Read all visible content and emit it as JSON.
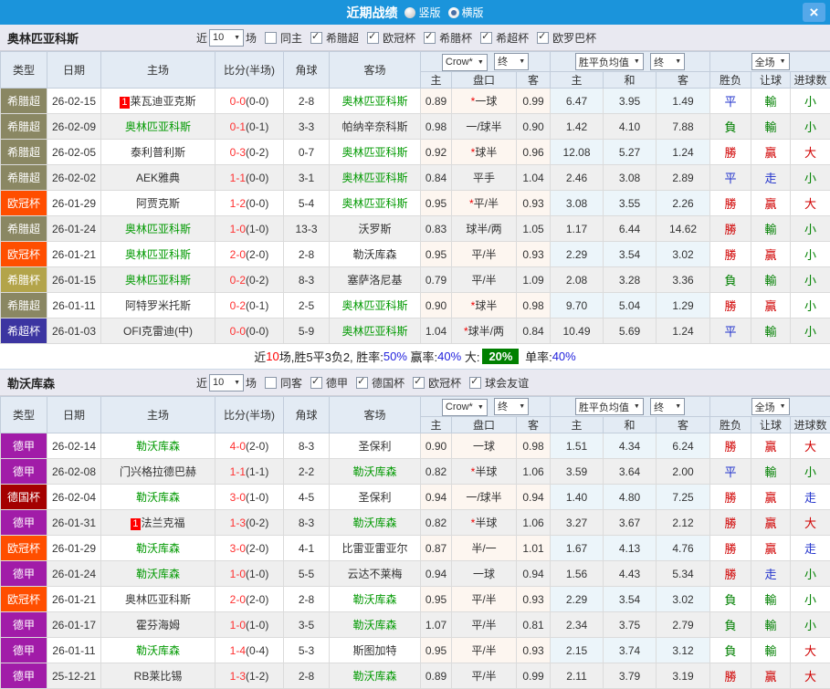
{
  "titlebar": {
    "title": "近期战绩",
    "vertical_label": "竖版",
    "horizontal_label": "横版",
    "selected_layout": "横版",
    "close_label": "×",
    "bar_color": "#1B94DB"
  },
  "table_header": {
    "cols": [
      "类型",
      "日期",
      "主场",
      "比分(半场)",
      "角球",
      "客场"
    ],
    "odds_dropdown": "Crow*",
    "final_dropdown": "终",
    "avg_dropdown": "胜平负均值",
    "final2_dropdown": "终",
    "fullgame_dropdown": "全场",
    "odds_cols": [
      "主",
      "盘口",
      "客"
    ],
    "avg_cols": [
      "主",
      "和",
      "客"
    ],
    "result_cols": [
      "胜负",
      "让球",
      "进球数"
    ]
  },
  "league_colors": {
    "希腊超": "#8A8763",
    "欧冠杯": "#FF4E00",
    "希腊杯": "#B3A44A",
    "希超杯": "#3C35A1",
    "德甲": "#A11CA8",
    "德国杯": "#A40000"
  },
  "result_colors": {
    "勝": "r",
    "贏": "r",
    "大": "r",
    "平": "b",
    "走": "b",
    "負": "g",
    "輸": "g",
    "小": "g"
  },
  "sections": [
    {
      "team": "奥林匹亚科斯",
      "filter": {
        "near": "近",
        "count": "10",
        "games": "场",
        "same": "同主",
        "same_checked": false,
        "leagues": [
          "希腊超",
          "欧冠杯",
          "希腊杯",
          "希超杯",
          "欧罗巴杯"
        ]
      },
      "rows": [
        {
          "league": "希腊超",
          "date": "26-02-15",
          "home": "莱瓦迪亚克斯",
          "home_badge": "1",
          "home_focus": false,
          "score": "0-0",
          "half": "(0-0)",
          "corners": "2-8",
          "away": "奥林匹亚科斯",
          "away_focus": true,
          "odds_home": "0.89",
          "handicap": "*一球",
          "odds_away": "0.99",
          "avg_home": "6.47",
          "avg_draw": "3.95",
          "avg_away": "1.49",
          "results": [
            "平",
            "輸",
            "小"
          ]
        },
        {
          "league": "希腊超",
          "date": "26-02-09",
          "home": "奥林匹亚科斯",
          "home_badge": "",
          "home_focus": true,
          "score": "0-1",
          "half": "(0-1)",
          "corners": "3-3",
          "away": "帕纳辛奈科斯",
          "away_focus": false,
          "odds_home": "0.98",
          "handicap": "一/球半",
          "odds_away": "0.90",
          "avg_home": "1.42",
          "avg_draw": "4.10",
          "avg_away": "7.88",
          "results": [
            "負",
            "輸",
            "小"
          ]
        },
        {
          "league": "希腊超",
          "date": "26-02-05",
          "home": "泰利普利斯",
          "home_badge": "",
          "home_focus": false,
          "score": "0-3",
          "half": "(0-2)",
          "corners": "0-7",
          "away": "奥林匹亚科斯",
          "away_focus": true,
          "odds_home": "0.92",
          "handicap": "*球半",
          "odds_away": "0.96",
          "avg_home": "12.08",
          "avg_draw": "5.27",
          "avg_away": "1.24",
          "results": [
            "勝",
            "贏",
            "大"
          ]
        },
        {
          "league": "希腊超",
          "date": "26-02-02",
          "home": "AEK雅典",
          "home_badge": "",
          "home_focus": false,
          "score": "1-1",
          "half": "(0-0)",
          "corners": "3-1",
          "away": "奥林匹亚科斯",
          "away_focus": true,
          "odds_home": "0.84",
          "handicap": "平手",
          "odds_away": "1.04",
          "avg_home": "2.46",
          "avg_draw": "3.08",
          "avg_away": "2.89",
          "results": [
            "平",
            "走",
            "小"
          ]
        },
        {
          "league": "欧冠杯",
          "date": "26-01-29",
          "home": "阿贾克斯",
          "home_badge": "",
          "home_focus": false,
          "score": "1-2",
          "half": "(0-0)",
          "corners": "5-4",
          "away": "奥林匹亚科斯",
          "away_focus": true,
          "odds_home": "0.95",
          "handicap": "*平/半",
          "odds_away": "0.93",
          "avg_home": "3.08",
          "avg_draw": "3.55",
          "avg_away": "2.26",
          "results": [
            "勝",
            "贏",
            "大"
          ]
        },
        {
          "league": "希腊超",
          "date": "26-01-24",
          "home": "奥林匹亚科斯",
          "home_badge": "",
          "home_focus": true,
          "score": "1-0",
          "half": "(1-0)",
          "corners": "13-3",
          "away": "沃罗斯",
          "away_focus": false,
          "odds_home": "0.83",
          "handicap": "球半/两",
          "odds_away": "1.05",
          "avg_home": "1.17",
          "avg_draw": "6.44",
          "avg_away": "14.62",
          "results": [
            "勝",
            "輸",
            "小"
          ]
        },
        {
          "league": "欧冠杯",
          "date": "26-01-21",
          "home": "奥林匹亚科斯",
          "home_badge": "",
          "home_focus": true,
          "score": "2-0",
          "half": "(2-0)",
          "corners": "2-8",
          "away": "勒沃库森",
          "away_focus": false,
          "odds_home": "0.95",
          "handicap": "平/半",
          "odds_away": "0.93",
          "avg_home": "2.29",
          "avg_draw": "3.54",
          "avg_away": "3.02",
          "results": [
            "勝",
            "贏",
            "小"
          ]
        },
        {
          "league": "希腊杯",
          "date": "26-01-15",
          "home": "奥林匹亚科斯",
          "home_badge": "",
          "home_focus": true,
          "score": "0-2",
          "half": "(0-2)",
          "corners": "8-3",
          "away": "塞萨洛尼基",
          "away_focus": false,
          "odds_home": "0.79",
          "handicap": "平/半",
          "odds_away": "1.09",
          "avg_home": "2.08",
          "avg_draw": "3.28",
          "avg_away": "3.36",
          "results": [
            "負",
            "輸",
            "小"
          ]
        },
        {
          "league": "希腊超",
          "date": "26-01-11",
          "home": "阿特罗米托斯",
          "home_badge": "",
          "home_focus": false,
          "score": "0-2",
          "half": "(0-1)",
          "corners": "2-5",
          "away": "奥林匹亚科斯",
          "away_focus": true,
          "odds_home": "0.90",
          "handicap": "*球半",
          "odds_away": "0.98",
          "avg_home": "9.70",
          "avg_draw": "5.04",
          "avg_away": "1.29",
          "results": [
            "勝",
            "贏",
            "小"
          ]
        },
        {
          "league": "希超杯",
          "date": "26-01-03",
          "home": "OFI克雷迪(中)",
          "home_badge": "",
          "home_focus": false,
          "score": "0-0",
          "half": "(0-0)",
          "corners": "5-9",
          "away": "奥林匹亚科斯",
          "away_focus": true,
          "odds_home": "1.04",
          "handicap": "*球半/两",
          "odds_away": "0.84",
          "avg_home": "10.49",
          "avg_draw": "5.69",
          "avg_away": "1.24",
          "results": [
            "平",
            "輸",
            "小"
          ]
        }
      ],
      "summary": [
        {
          "text": "近",
          "style": "k"
        },
        {
          "text": "10",
          "style": "r"
        },
        {
          "text": "场,胜5平3负2, ",
          "style": "k"
        },
        {
          "text": "胜率:",
          "style": "k"
        },
        {
          "text": "50%",
          "style": "b"
        },
        {
          "text": " 赢率:",
          "style": "k"
        },
        {
          "text": "40%",
          "style": "b"
        },
        {
          "text": " 大:",
          "style": "k"
        },
        {
          "text": "20%",
          "style": "g"
        },
        {
          "text": " 单率:",
          "style": "k"
        },
        {
          "text": "40%",
          "style": "b"
        }
      ]
    },
    {
      "team": "勒沃库森",
      "filter": {
        "near": "近",
        "count": "10",
        "games": "场",
        "same": "同客",
        "same_checked": false,
        "leagues": [
          "德甲",
          "德国杯",
          "欧冠杯",
          "球会友谊"
        ]
      },
      "rows": [
        {
          "league": "德甲",
          "date": "26-02-14",
          "home": "勒沃库森",
          "home_badge": "",
          "home_focus": true,
          "score": "4-0",
          "half": "(2-0)",
          "corners": "8-3",
          "away": "圣保利",
          "away_focus": false,
          "odds_home": "0.90",
          "handicap": "一球",
          "odds_away": "0.98",
          "avg_home": "1.51",
          "avg_draw": "4.34",
          "avg_away": "6.24",
          "results": [
            "勝",
            "贏",
            "大"
          ]
        },
        {
          "league": "德甲",
          "date": "26-02-08",
          "home": "门兴格拉德巴赫",
          "home_badge": "",
          "home_focus": false,
          "score": "1-1",
          "half": "(1-1)",
          "corners": "2-2",
          "away": "勒沃库森",
          "away_focus": true,
          "odds_home": "0.82",
          "handicap": "*半球",
          "odds_away": "1.06",
          "avg_home": "3.59",
          "avg_draw": "3.64",
          "avg_away": "2.00",
          "results": [
            "平",
            "輸",
            "小"
          ]
        },
        {
          "league": "德国杯",
          "date": "26-02-04",
          "home": "勒沃库森",
          "home_badge": "",
          "home_focus": true,
          "score": "3-0",
          "half": "(1-0)",
          "corners": "4-5",
          "away": "圣保利",
          "away_focus": false,
          "odds_home": "0.94",
          "handicap": "一/球半",
          "odds_away": "0.94",
          "avg_home": "1.40",
          "avg_draw": "4.80",
          "avg_away": "7.25",
          "results": [
            "勝",
            "贏",
            "走"
          ]
        },
        {
          "league": "德甲",
          "date": "26-01-31",
          "home": "法兰克福",
          "home_badge": "1",
          "home_focus": false,
          "score": "1-3",
          "half": "(0-2)",
          "corners": "8-3",
          "away": "勒沃库森",
          "away_focus": true,
          "odds_home": "0.82",
          "handicap": "*半球",
          "odds_away": "1.06",
          "avg_home": "3.27",
          "avg_draw": "3.67",
          "avg_away": "2.12",
          "results": [
            "勝",
            "贏",
            "大"
          ]
        },
        {
          "league": "欧冠杯",
          "date": "26-01-29",
          "home": "勒沃库森",
          "home_badge": "",
          "home_focus": true,
          "score": "3-0",
          "half": "(2-0)",
          "corners": "4-1",
          "away": "比雷亚雷亚尔",
          "away_focus": false,
          "odds_home": "0.87",
          "handicap": "半/一",
          "odds_away": "1.01",
          "avg_home": "1.67",
          "avg_draw": "4.13",
          "avg_away": "4.76",
          "results": [
            "勝",
            "贏",
            "走"
          ]
        },
        {
          "league": "德甲",
          "date": "26-01-24",
          "home": "勒沃库森",
          "home_badge": "",
          "home_focus": true,
          "score": "1-0",
          "half": "(1-0)",
          "corners": "5-5",
          "away": "云达不莱梅",
          "away_focus": false,
          "odds_home": "0.94",
          "handicap": "一球",
          "odds_away": "0.94",
          "avg_home": "1.56",
          "avg_draw": "4.43",
          "avg_away": "5.34",
          "results": [
            "勝",
            "走",
            "小"
          ]
        },
        {
          "league": "欧冠杯",
          "date": "26-01-21",
          "home": "奥林匹亚科斯",
          "home_badge": "",
          "home_focus": false,
          "score": "2-0",
          "half": "(2-0)",
          "corners": "2-8",
          "away": "勒沃库森",
          "away_focus": true,
          "odds_home": "0.95",
          "handicap": "平/半",
          "odds_away": "0.93",
          "avg_home": "2.29",
          "avg_draw": "3.54",
          "avg_away": "3.02",
          "results": [
            "負",
            "輸",
            "小"
          ]
        },
        {
          "league": "德甲",
          "date": "26-01-17",
          "home": "霍芬海姆",
          "home_badge": "",
          "home_focus": false,
          "score": "1-0",
          "half": "(1-0)",
          "corners": "3-5",
          "away": "勒沃库森",
          "away_focus": true,
          "odds_home": "1.07",
          "handicap": "平/半",
          "odds_away": "0.81",
          "avg_home": "2.34",
          "avg_draw": "3.75",
          "avg_away": "2.79",
          "results": [
            "負",
            "輸",
            "小"
          ]
        },
        {
          "league": "德甲",
          "date": "26-01-11",
          "home": "勒沃库森",
          "home_badge": "",
          "home_focus": true,
          "score": "1-4",
          "half": "(0-4)",
          "corners": "5-3",
          "away": "斯图加特",
          "away_focus": false,
          "odds_home": "0.95",
          "handicap": "平/半",
          "odds_away": "0.93",
          "avg_home": "2.15",
          "avg_draw": "3.74",
          "avg_away": "3.12",
          "results": [
            "負",
            "輸",
            "大"
          ]
        },
        {
          "league": "德甲",
          "date": "25-12-21",
          "home": "RB莱比锡",
          "home_badge": "",
          "home_focus": false,
          "score": "1-3",
          "half": "(1-2)",
          "corners": "2-8",
          "away": "勒沃库森",
          "away_focus": true,
          "odds_home": "0.89",
          "handicap": "平/半",
          "odds_away": "0.99",
          "avg_home": "2.11",
          "avg_draw": "3.79",
          "avg_away": "3.19",
          "results": [
            "勝",
            "贏",
            "大"
          ]
        }
      ],
      "summary": null
    }
  ]
}
